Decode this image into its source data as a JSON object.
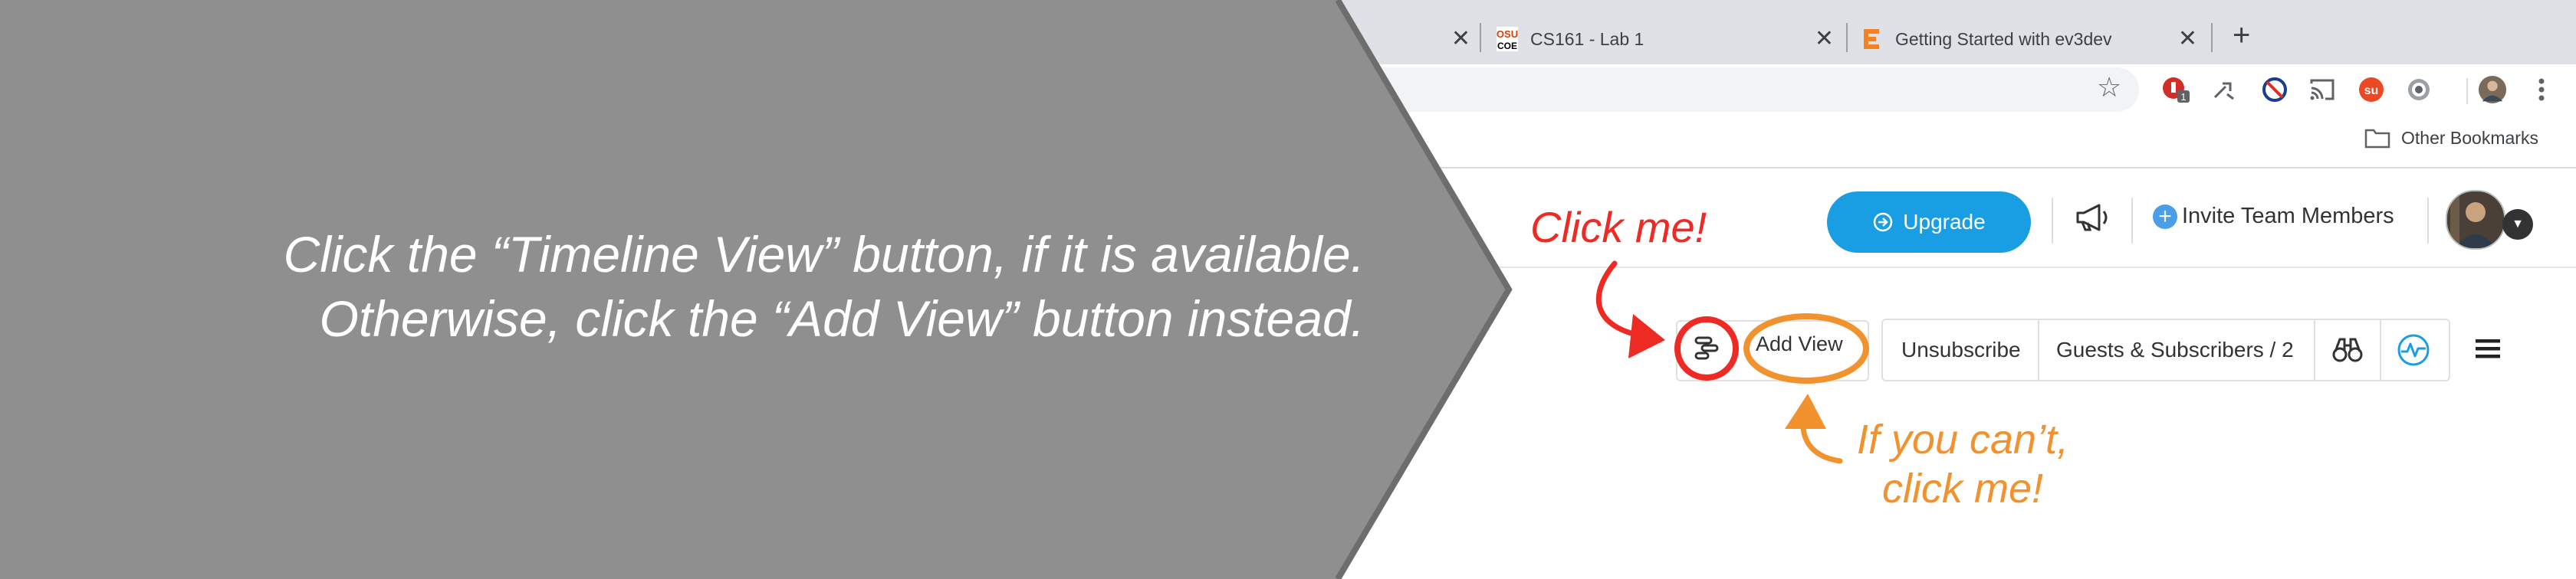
{
  "browser": {
    "tabs": [
      {
        "title": "",
        "favicon": "tab-favicon"
      },
      {
        "title": "CS161 - Lab 1",
        "favicon": "osu-coe-logo"
      },
      {
        "title": "Getting Started with ev3dev",
        "favicon": "ev3dev-logo"
      }
    ],
    "new_tab": "+",
    "close_glyph": "✕",
    "bookmark_other": "Other Bookmarks",
    "extensions": [
      "lastpass-icon",
      "tool-icon",
      "blocker-icon",
      "cast-icon",
      "stumbleupon-icon",
      "settings-icon",
      "profile-icon"
    ],
    "extension_badge": "1"
  },
  "app": {
    "upgrade_label": "Upgrade",
    "invite_label": "Invite Team Members",
    "addview_label": "Add View",
    "unsubscribe_label": "Unsubscribe",
    "guests_label": "Guests & Subscribers / 2"
  },
  "overlay": {
    "instruction_line1": "Click the “Timeline View” button, if it is available.",
    "instruction_line2": "Otherwise, click the “Add View” button instead.",
    "click_me": "Click me!",
    "fallback_line1": "If you can’t,",
    "fallback_line2": "click me!"
  },
  "colors": {
    "overlay_gray": "#8f8f8f",
    "annotation_red": "#ee2a24",
    "annotation_orange": "#f2922e",
    "upgrade_blue": "#1a9ee3"
  }
}
